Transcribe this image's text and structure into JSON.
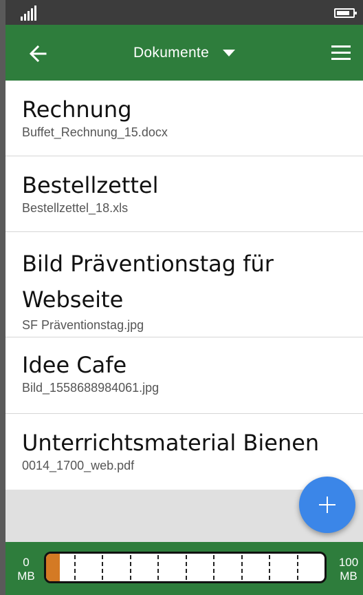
{
  "app": {
    "title": "Dokumente",
    "icons": {
      "back": "arrow-left-icon",
      "dropdown": "caret-down-icon",
      "menu": "hamburger-menu-icon",
      "add": "plus-icon"
    }
  },
  "colors": {
    "appbar": "#2e7d3c",
    "fab": "#3b86e8",
    "storage_fill": "#d47a24"
  },
  "documents": [
    {
      "title": "Rechnung",
      "file": "Buffet_Rechnung_15.docx"
    },
    {
      "title": "Bestellzettel",
      "file": "Bestellzettel_18.xls"
    },
    {
      "title": "Bild Präventionstag für Webseite",
      "file": "SF Präventionstag.jpg"
    },
    {
      "title": "Idee Cafe",
      "file": "Bild_1558688984061.jpg"
    },
    {
      "title": "Unterrichtsmaterial Bienen",
      "file": "0014_1700_web.pdf"
    }
  ],
  "storage": {
    "min_value": "0",
    "min_unit": "MB",
    "max_value": "100",
    "max_unit": "MB",
    "used_fraction": 0.05
  }
}
